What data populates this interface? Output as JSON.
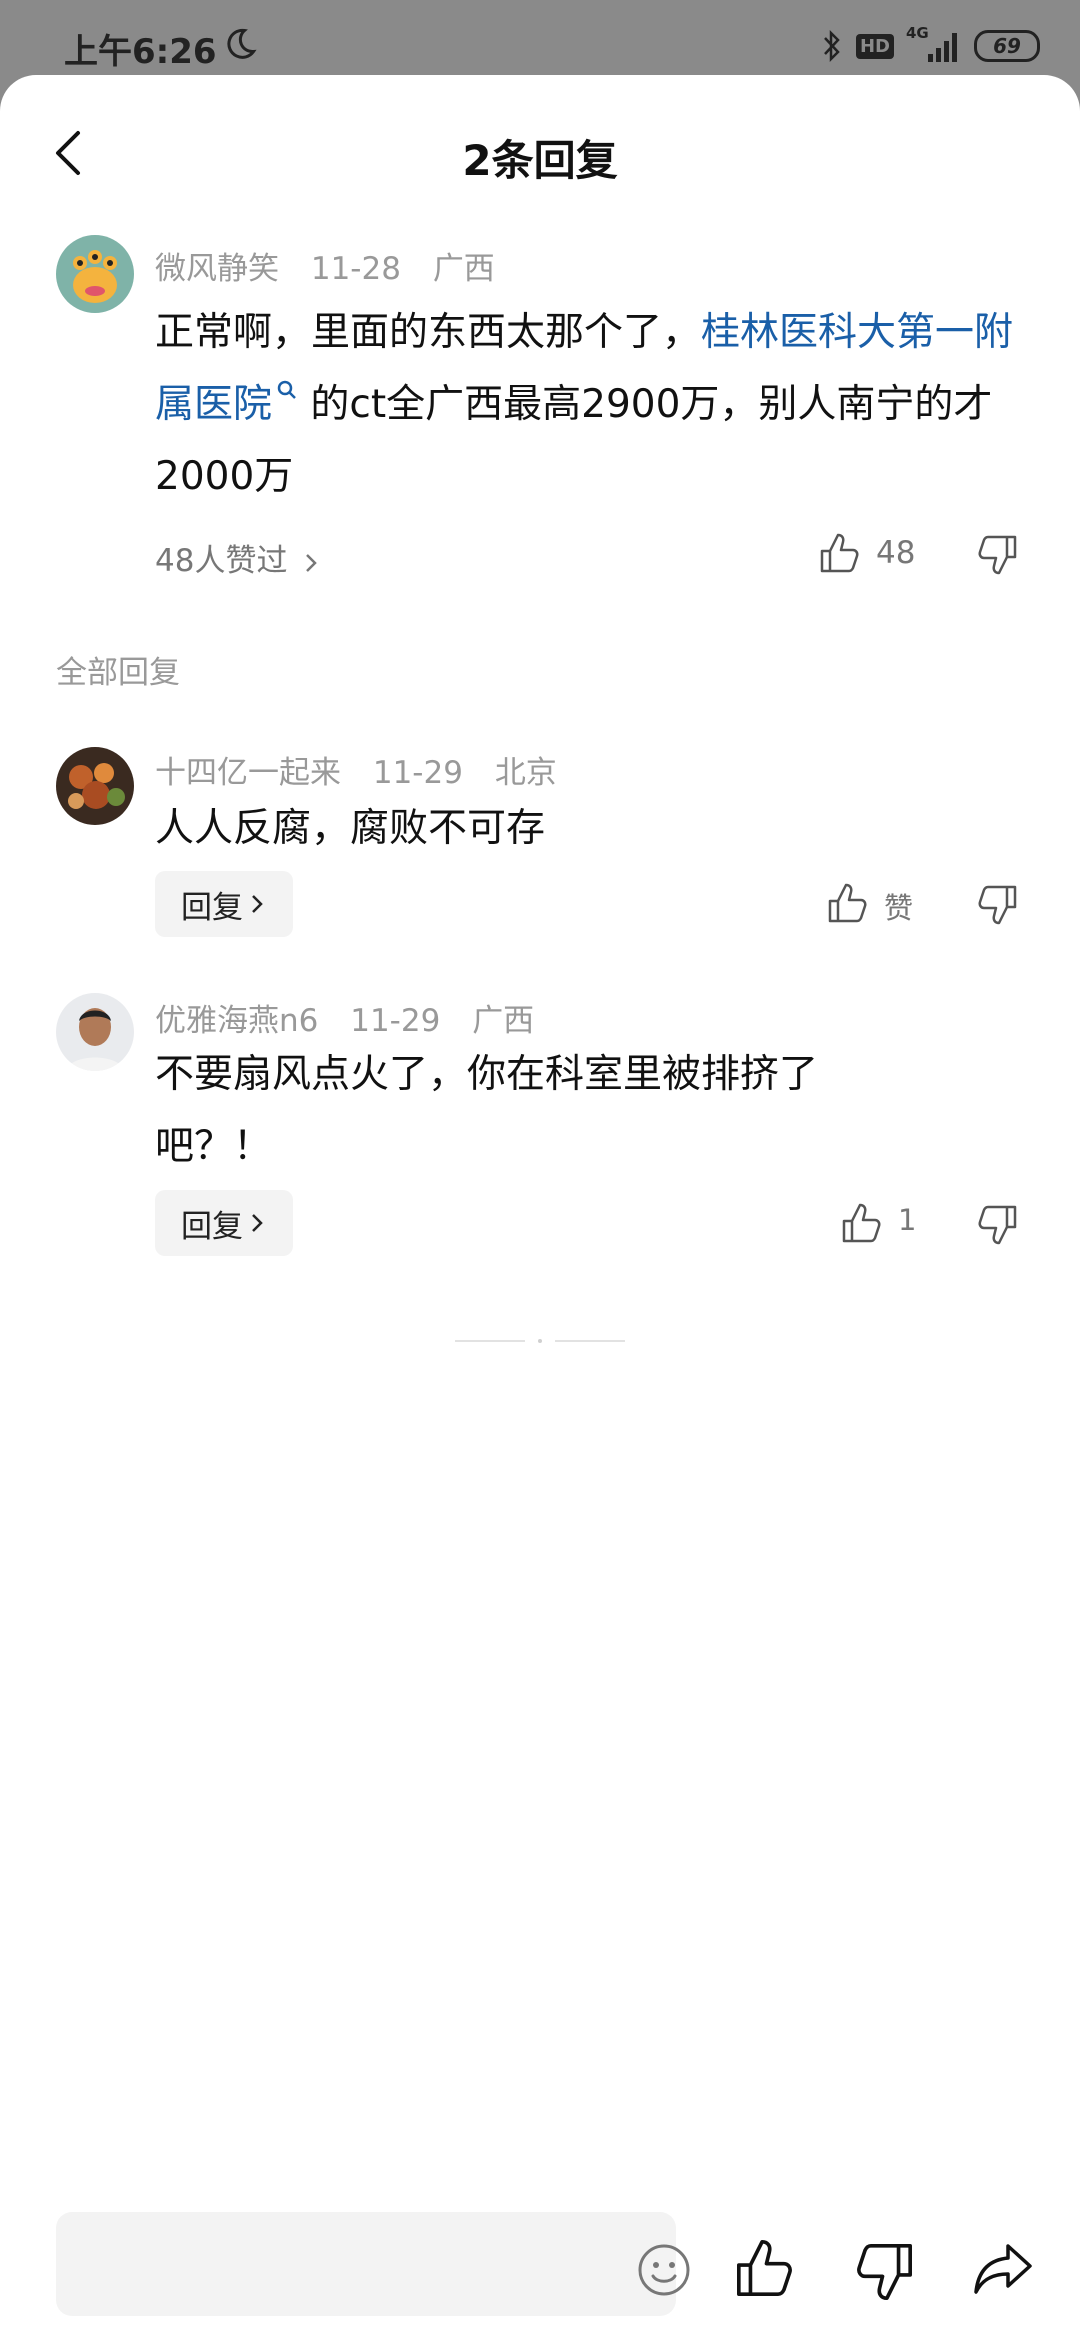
{
  "status_bar": {
    "time": "上午6:26",
    "hd": "HD",
    "network": "4G",
    "battery": "69"
  },
  "header": {
    "title": "2条回复"
  },
  "main_comment": {
    "author": "微风静笑",
    "date": "11-28",
    "location": "广西",
    "text_before": "正常啊，里面的东西太那个了，",
    "link_text": "桂林医科大第一附属医院",
    "text_after": " 的ct全广西最高2900万，别人南宁的才2000万",
    "likes_summary": "48人赞过",
    "like_count": "48"
  },
  "section_label": "全部回复",
  "replies": [
    {
      "author": "十四亿一起来",
      "date": "11-29",
      "location": "北京",
      "text": "人人反腐，腐败不可存",
      "reply_label": "回复",
      "like_label": "赞"
    },
    {
      "author": "优雅海燕n6",
      "date": "11-29",
      "location": "广西",
      "text": "不要扇风点火了，你在科室里被排挤了吧？！",
      "reply_label": "回复",
      "like_label": "1"
    }
  ],
  "colors": {
    "link": "#1a5fa8",
    "meta": "#999999",
    "chip_bg": "#f3f3f3"
  },
  "icons": [
    "back-arrow-icon",
    "thumbs-up-icon",
    "thumbs-down-icon",
    "emoji-icon",
    "share-icon",
    "moon-icon",
    "bluetooth-icon",
    "signal-icon"
  ]
}
